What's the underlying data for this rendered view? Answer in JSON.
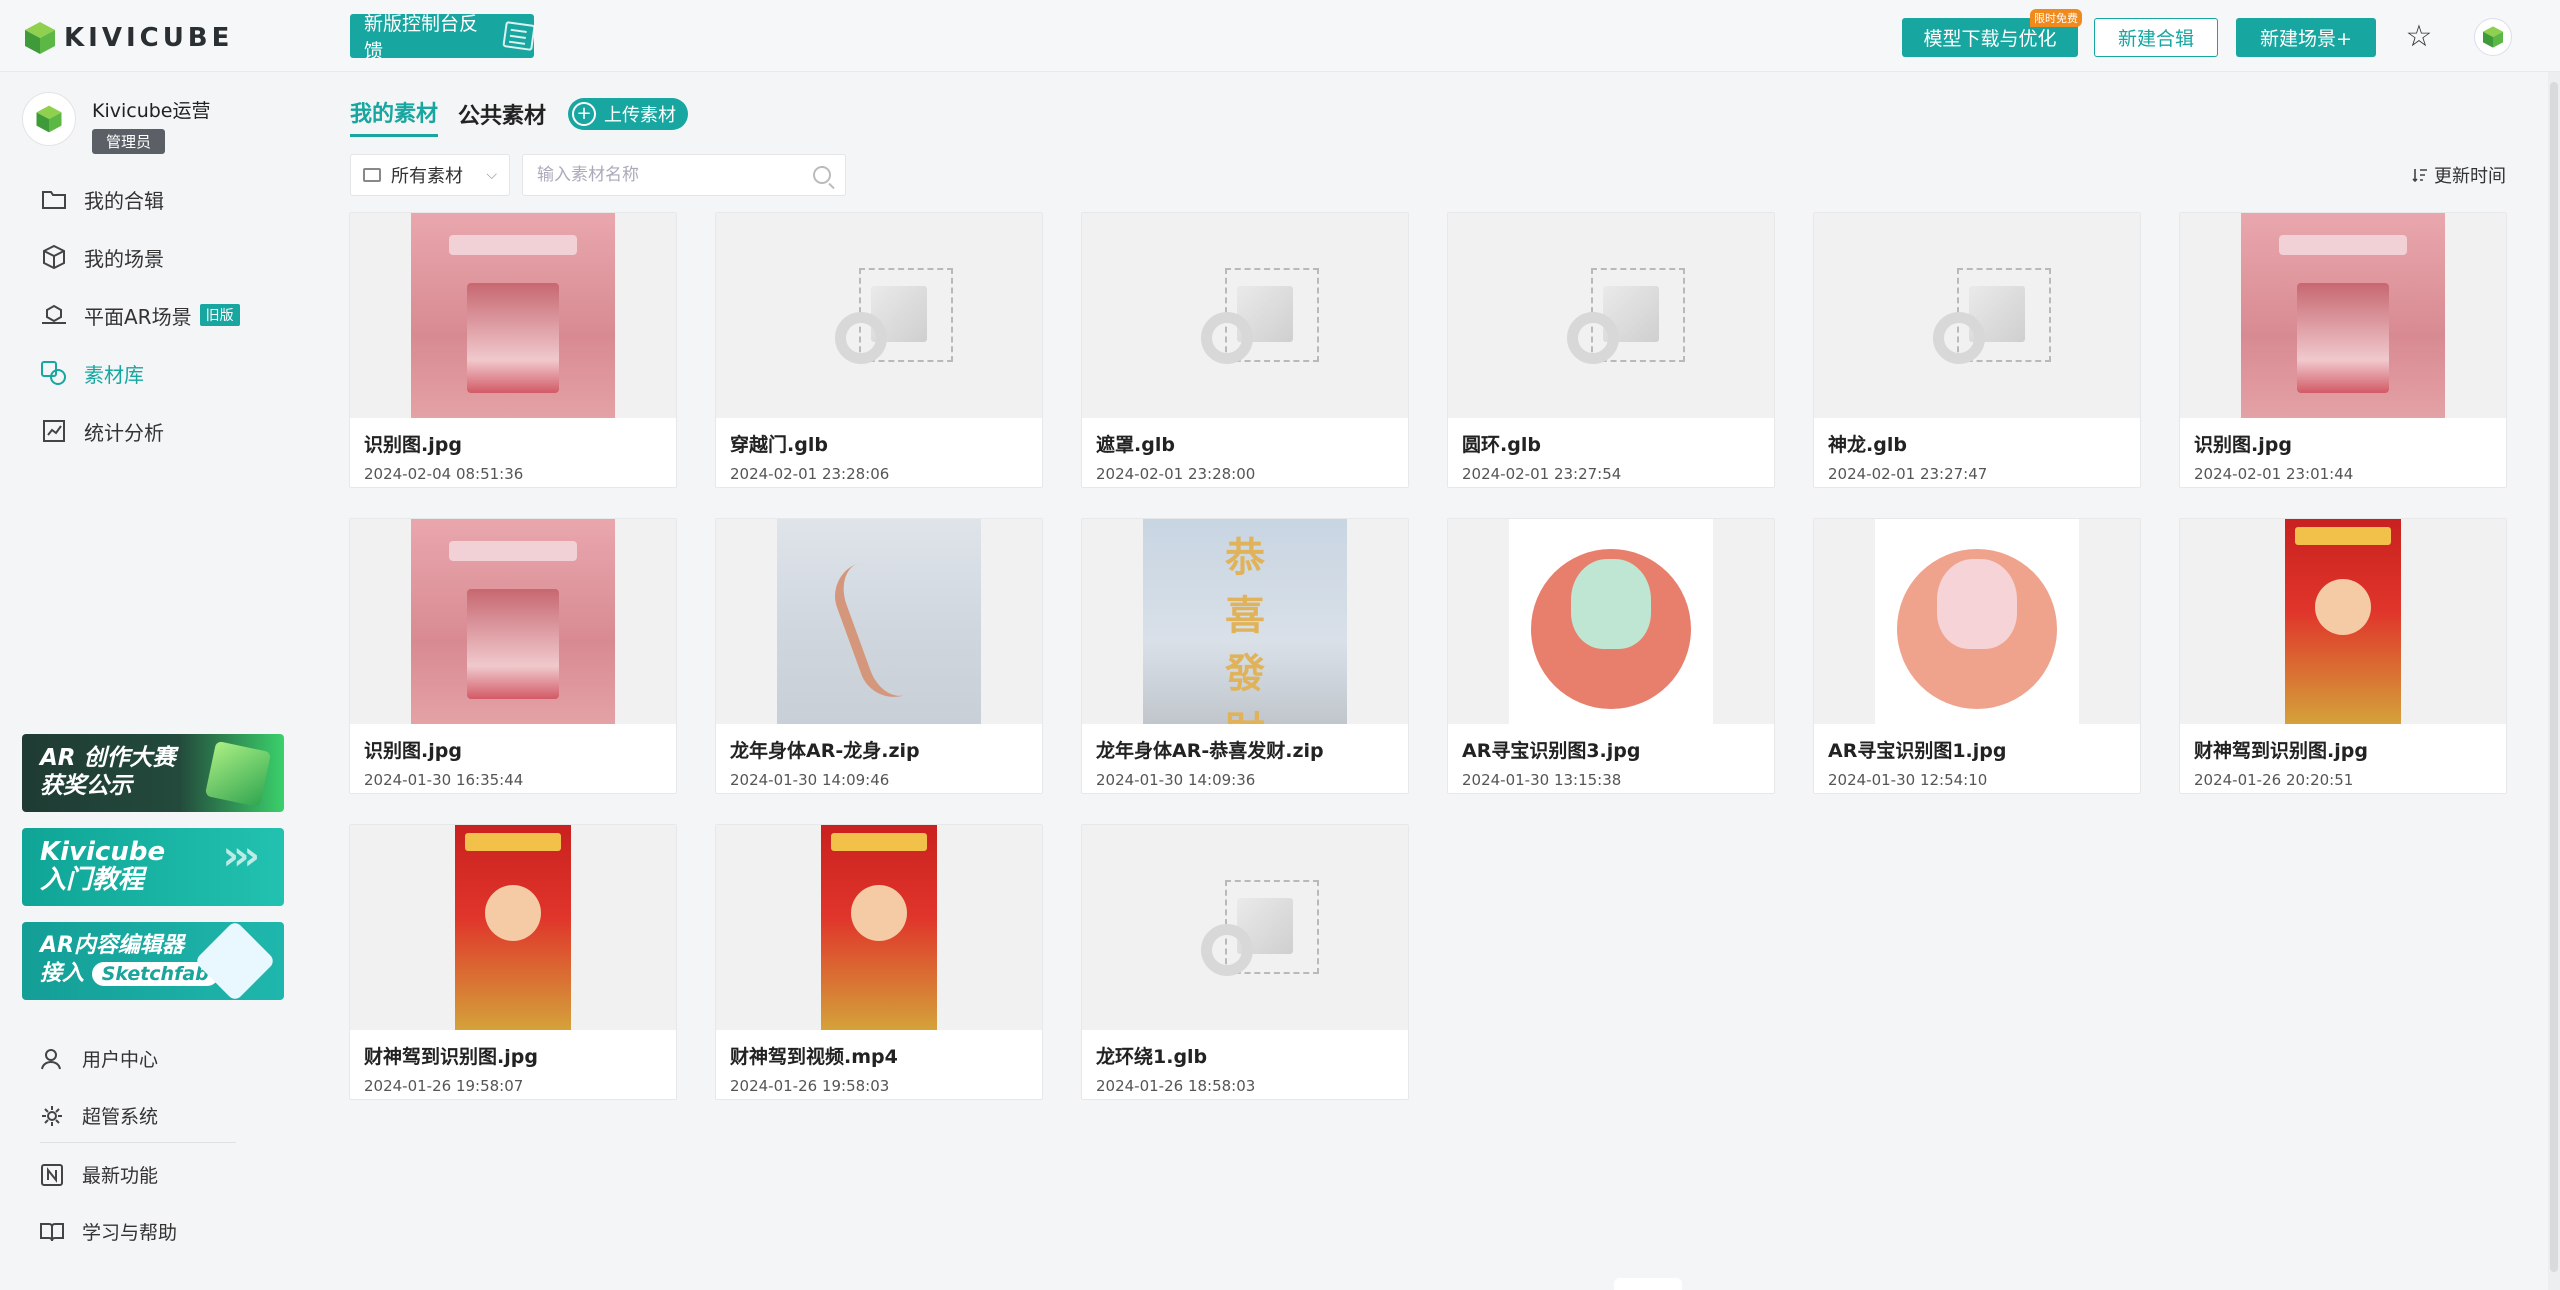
{
  "brand": {
    "logo_text": "KIVICUBE"
  },
  "header": {
    "feedback_label": "新版控制台反馈",
    "download_label": "模型下载与优化",
    "download_badge": "限时免费",
    "new_album_label": "新建合辑",
    "new_scene_label": "新建场景+"
  },
  "user": {
    "name": "Kivicube运营",
    "role": "管理员"
  },
  "sidebar": {
    "items": [
      {
        "label": "我的合辑",
        "icon": "folder-icon"
      },
      {
        "label": "我的场景",
        "icon": "cube-icon"
      },
      {
        "label": "平面AR场景",
        "icon": "ar-plane-icon",
        "badge": "旧版"
      },
      {
        "label": "素材库",
        "icon": "material-library-icon",
        "active": true
      },
      {
        "label": "统计分析",
        "icon": "chart-icon"
      }
    ],
    "promos": [
      {
        "line1": "AR 创作大赛",
        "line2": "获奖公示"
      },
      {
        "line1": "Kivicube",
        "line2": "入门教程"
      },
      {
        "line1": "AR内容编辑器",
        "line2": "接入",
        "tag": "Sketchfab"
      }
    ],
    "bottom_items": [
      {
        "label": "用户中心",
        "icon": "user-icon"
      },
      {
        "label": "超管系统",
        "icon": "gear-icon"
      },
      {
        "label": "最新功能",
        "icon": "new-feature-icon"
      },
      {
        "label": "学习与帮助",
        "icon": "book-icon"
      }
    ]
  },
  "main": {
    "tabs": [
      {
        "label": "我的素材",
        "active": true
      },
      {
        "label": "公共素材",
        "active": false
      }
    ],
    "upload_label": "上传素材",
    "filter_value": "所有素材",
    "search_placeholder": "输入素材名称",
    "sort_label": "更新时间",
    "cards": [
      {
        "name": "识别图.jpg",
        "date": "2024-02-04 08:51:36",
        "thumb": "pagoda"
      },
      {
        "name": "穿越门.glb",
        "date": "2024-02-01 23:28:06",
        "thumb": "placeholder"
      },
      {
        "name": "遮罩.glb",
        "date": "2024-02-01 23:28:00",
        "thumb": "placeholder"
      },
      {
        "name": "圆环.glb",
        "date": "2024-02-01 23:27:54",
        "thumb": "placeholder"
      },
      {
        "name": "神龙.glb",
        "date": "2024-02-01 23:27:47",
        "thumb": "placeholder"
      },
      {
        "name": "识别图.jpg",
        "date": "2024-02-01 23:01:44",
        "thumb": "pagoda"
      },
      {
        "name": "识别图.jpg",
        "date": "2024-01-30 16:35:44",
        "thumb": "pagoda"
      },
      {
        "name": "龙年身体AR-龙身.zip",
        "date": "2024-01-30 14:09:46",
        "thumb": "dragon-grid"
      },
      {
        "name": "龙年身体AR-恭喜发财.zip",
        "date": "2024-01-30 14:09:36",
        "thumb": "gongxi"
      },
      {
        "name": "AR寻宝识别图3.jpg",
        "date": "2024-01-30 13:15:38",
        "thumb": "circle-dragon"
      },
      {
        "name": "AR寻宝识别图1.jpg",
        "date": "2024-01-30 12:54:10",
        "thumb": "circle-dragon-pink"
      },
      {
        "name": "财神驾到识别图.jpg",
        "date": "2024-01-26 20:20:51",
        "thumb": "caishen"
      },
      {
        "name": "财神驾到识别图.jpg",
        "date": "2024-01-26 19:58:07",
        "thumb": "caishen"
      },
      {
        "name": "财神驾到视频.mp4",
        "date": "2024-01-26 19:58:03",
        "thumb": "caishen"
      },
      {
        "name": "龙环绕1.glb",
        "date": "2024-01-26 18:58:03",
        "thumb": "placeholder"
      }
    ]
  },
  "colors": {
    "accent": "#17a6a0",
    "hot_badge": "#f08a1c"
  }
}
